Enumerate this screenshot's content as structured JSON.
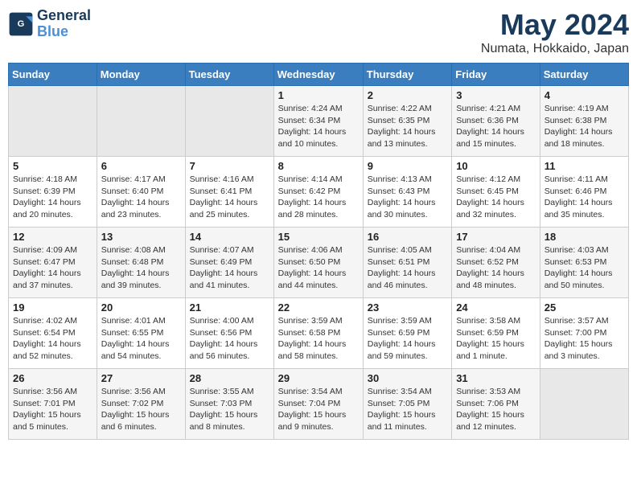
{
  "logo": {
    "line1": "General",
    "line2": "Blue"
  },
  "title": "May 2024",
  "location": "Numata, Hokkaido, Japan",
  "days_of_week": [
    "Sunday",
    "Monday",
    "Tuesday",
    "Wednesday",
    "Thursday",
    "Friday",
    "Saturday"
  ],
  "weeks": [
    [
      {
        "day": "",
        "info": ""
      },
      {
        "day": "",
        "info": ""
      },
      {
        "day": "",
        "info": ""
      },
      {
        "day": "1",
        "info": "Sunrise: 4:24 AM\nSunset: 6:34 PM\nDaylight: 14 hours\nand 10 minutes."
      },
      {
        "day": "2",
        "info": "Sunrise: 4:22 AM\nSunset: 6:35 PM\nDaylight: 14 hours\nand 13 minutes."
      },
      {
        "day": "3",
        "info": "Sunrise: 4:21 AM\nSunset: 6:36 PM\nDaylight: 14 hours\nand 15 minutes."
      },
      {
        "day": "4",
        "info": "Sunrise: 4:19 AM\nSunset: 6:38 PM\nDaylight: 14 hours\nand 18 minutes."
      }
    ],
    [
      {
        "day": "5",
        "info": "Sunrise: 4:18 AM\nSunset: 6:39 PM\nDaylight: 14 hours\nand 20 minutes."
      },
      {
        "day": "6",
        "info": "Sunrise: 4:17 AM\nSunset: 6:40 PM\nDaylight: 14 hours\nand 23 minutes."
      },
      {
        "day": "7",
        "info": "Sunrise: 4:16 AM\nSunset: 6:41 PM\nDaylight: 14 hours\nand 25 minutes."
      },
      {
        "day": "8",
        "info": "Sunrise: 4:14 AM\nSunset: 6:42 PM\nDaylight: 14 hours\nand 28 minutes."
      },
      {
        "day": "9",
        "info": "Sunrise: 4:13 AM\nSunset: 6:43 PM\nDaylight: 14 hours\nand 30 minutes."
      },
      {
        "day": "10",
        "info": "Sunrise: 4:12 AM\nSunset: 6:45 PM\nDaylight: 14 hours\nand 32 minutes."
      },
      {
        "day": "11",
        "info": "Sunrise: 4:11 AM\nSunset: 6:46 PM\nDaylight: 14 hours\nand 35 minutes."
      }
    ],
    [
      {
        "day": "12",
        "info": "Sunrise: 4:09 AM\nSunset: 6:47 PM\nDaylight: 14 hours\nand 37 minutes."
      },
      {
        "day": "13",
        "info": "Sunrise: 4:08 AM\nSunset: 6:48 PM\nDaylight: 14 hours\nand 39 minutes."
      },
      {
        "day": "14",
        "info": "Sunrise: 4:07 AM\nSunset: 6:49 PM\nDaylight: 14 hours\nand 41 minutes."
      },
      {
        "day": "15",
        "info": "Sunrise: 4:06 AM\nSunset: 6:50 PM\nDaylight: 14 hours\nand 44 minutes."
      },
      {
        "day": "16",
        "info": "Sunrise: 4:05 AM\nSunset: 6:51 PM\nDaylight: 14 hours\nand 46 minutes."
      },
      {
        "day": "17",
        "info": "Sunrise: 4:04 AM\nSunset: 6:52 PM\nDaylight: 14 hours\nand 48 minutes."
      },
      {
        "day": "18",
        "info": "Sunrise: 4:03 AM\nSunset: 6:53 PM\nDaylight: 14 hours\nand 50 minutes."
      }
    ],
    [
      {
        "day": "19",
        "info": "Sunrise: 4:02 AM\nSunset: 6:54 PM\nDaylight: 14 hours\nand 52 minutes."
      },
      {
        "day": "20",
        "info": "Sunrise: 4:01 AM\nSunset: 6:55 PM\nDaylight: 14 hours\nand 54 minutes."
      },
      {
        "day": "21",
        "info": "Sunrise: 4:00 AM\nSunset: 6:56 PM\nDaylight: 14 hours\nand 56 minutes."
      },
      {
        "day": "22",
        "info": "Sunrise: 3:59 AM\nSunset: 6:58 PM\nDaylight: 14 hours\nand 58 minutes."
      },
      {
        "day": "23",
        "info": "Sunrise: 3:59 AM\nSunset: 6:59 PM\nDaylight: 14 hours\nand 59 minutes."
      },
      {
        "day": "24",
        "info": "Sunrise: 3:58 AM\nSunset: 6:59 PM\nDaylight: 15 hours\nand 1 minute."
      },
      {
        "day": "25",
        "info": "Sunrise: 3:57 AM\nSunset: 7:00 PM\nDaylight: 15 hours\nand 3 minutes."
      }
    ],
    [
      {
        "day": "26",
        "info": "Sunrise: 3:56 AM\nSunset: 7:01 PM\nDaylight: 15 hours\nand 5 minutes."
      },
      {
        "day": "27",
        "info": "Sunrise: 3:56 AM\nSunset: 7:02 PM\nDaylight: 15 hours\nand 6 minutes."
      },
      {
        "day": "28",
        "info": "Sunrise: 3:55 AM\nSunset: 7:03 PM\nDaylight: 15 hours\nand 8 minutes."
      },
      {
        "day": "29",
        "info": "Sunrise: 3:54 AM\nSunset: 7:04 PM\nDaylight: 15 hours\nand 9 minutes."
      },
      {
        "day": "30",
        "info": "Sunrise: 3:54 AM\nSunset: 7:05 PM\nDaylight: 15 hours\nand 11 minutes."
      },
      {
        "day": "31",
        "info": "Sunrise: 3:53 AM\nSunset: 7:06 PM\nDaylight: 15 hours\nand 12 minutes."
      },
      {
        "day": "",
        "info": ""
      }
    ]
  ]
}
